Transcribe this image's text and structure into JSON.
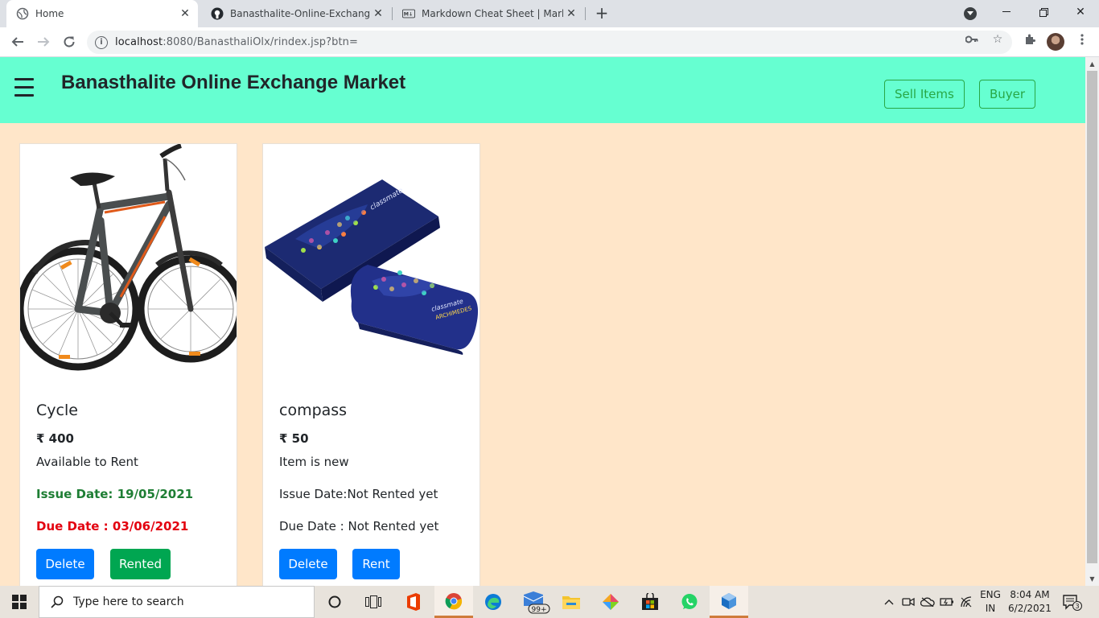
{
  "browser": {
    "tabs": [
      {
        "title": "Home",
        "active": true
      },
      {
        "title": "Banasthalite-Online-Exchange-M",
        "active": false
      },
      {
        "title": "Markdown Cheat Sheet | Markdo",
        "active": false
      }
    ],
    "url_host": "localhost",
    "url_path": ":8080/BanasthaliOlx/rindex.jsp?btn="
  },
  "navbar": {
    "brand": "Banasthalite Online Exchange Market",
    "sell_label": "Sell Items",
    "buyer_label": "Buyer"
  },
  "items": [
    {
      "name": "Cycle",
      "price": "₹ 400",
      "status": "Available to Rent",
      "issue": "Issue Date: 19/05/2021",
      "due": "Due Date : 03/06/2021",
      "delete_label": "Delete",
      "action_label": "Rented"
    },
    {
      "name": "compass",
      "price": "₹ 50",
      "status": "Item is new",
      "issue": "Issue Date:Not Rented yet",
      "due": "Due Date : Not Rented yet",
      "delete_label": "Delete",
      "action_label": "Rent"
    }
  ],
  "taskbar": {
    "search_placeholder": "Type here to search",
    "mail_badge": "99+",
    "lang_line1": "ENG",
    "lang_line2": "IN",
    "time": "8:04 AM",
    "date": "6/2/2021",
    "notification_count": "3"
  },
  "colors": {
    "navbar_bg": "#66ffd1",
    "page_bg": "#ffe6c9",
    "primary": "#007bff",
    "success": "#00a651",
    "issue_green": "#1e7e34",
    "due_red": "#e3000f"
  }
}
